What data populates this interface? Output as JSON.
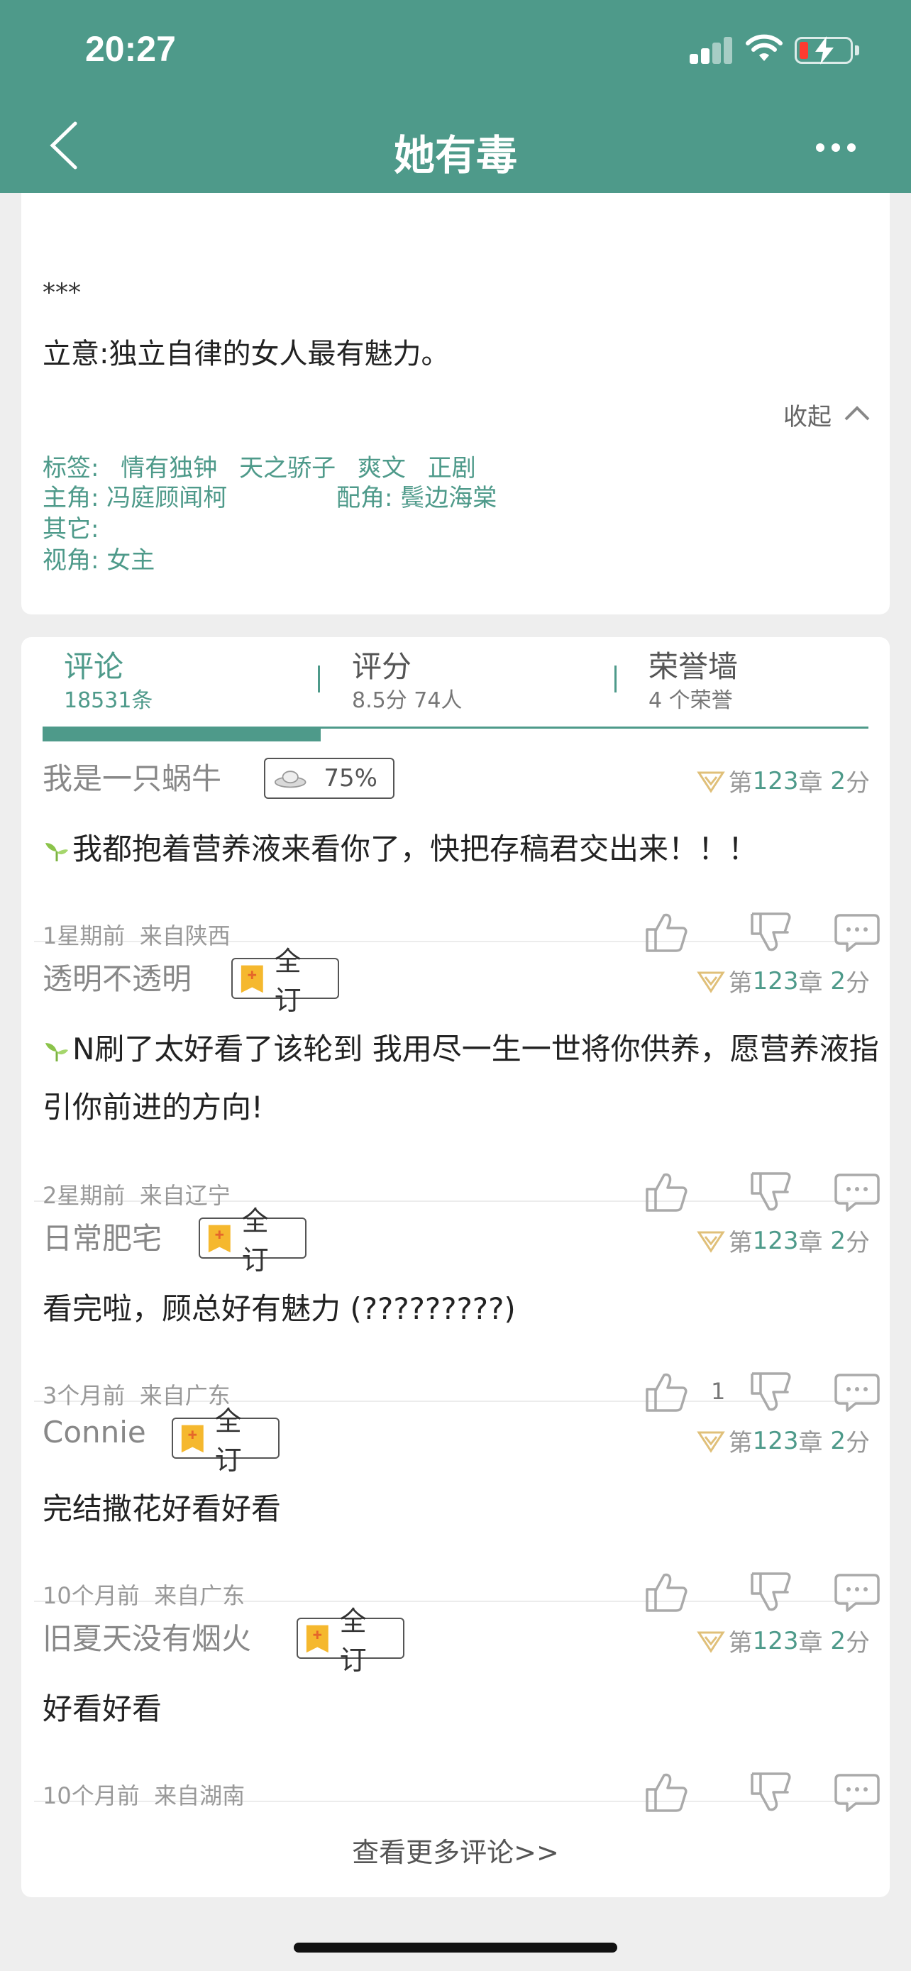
{
  "status": {
    "time": "20:27"
  },
  "header": {
    "title": "她有毒"
  },
  "intro": {
    "divider": "***",
    "theme": "立意:独立自律的女人最有魅力。",
    "collapse_label": "收起",
    "tags_label": "标签:",
    "tags": [
      "情有独钟",
      "天之骄子",
      "爽文",
      "正剧"
    ],
    "lead_label": "主角:",
    "lead": "冯庭顾闻柯",
    "support_label": "配角:",
    "support": "鬓边海棠",
    "other_label": "其它:",
    "pov_label": "视角:",
    "pov": "女主"
  },
  "tabs": [
    {
      "label": "评论",
      "sub": "18531条"
    },
    {
      "label": "评分",
      "sub": "8.5分 74人"
    },
    {
      "label": "荣誉墙",
      "sub": "4 个荣誉"
    }
  ],
  "comments": [
    {
      "user": "我是一只蜗牛",
      "badge_type": "percent",
      "badge": "75%",
      "chap_prefix": "第",
      "chapter": "123",
      "chap_mid": "章",
      "score": "2",
      "score_unit": "分",
      "text": "我都抱着营养液来看你了，快把存稿君交出来！！！",
      "sprout": true,
      "time": "1星期前",
      "location": "来自陕西",
      "likes": ""
    },
    {
      "user": "透明不透明",
      "badge_type": "sub",
      "badge": "全订",
      "chap_prefix": "第",
      "chapter": "123",
      "chap_mid": "章",
      "score": "2",
      "score_unit": "分",
      "text": "N刷了太好看了该轮到 我用尽一生一世将你供养，愿营养液指引你前进的方向!",
      "sprout": true,
      "time": "2星期前",
      "location": "来自辽宁",
      "likes": ""
    },
    {
      "user": "日常肥宅",
      "badge_type": "sub",
      "badge": "全订",
      "chap_prefix": "第",
      "chapter": "123",
      "chap_mid": "章",
      "score": "2",
      "score_unit": "分",
      "text": "看完啦，顾总好有魅力 (?????????)",
      "sprout": false,
      "time": "3个月前",
      "location": "来自广东",
      "likes": "1"
    },
    {
      "user": "Connie",
      "badge_type": "sub",
      "badge": "全订",
      "chap_prefix": "第",
      "chapter": "123",
      "chap_mid": "章",
      "score": "2",
      "score_unit": "分",
      "text": "完结撒花好看好看",
      "sprout": false,
      "time": "10个月前",
      "location": "来自广东",
      "likes": ""
    },
    {
      "user": "旧夏天没有烟火",
      "badge_type": "sub",
      "badge": "全订",
      "chap_prefix": "第",
      "chapter": "123",
      "chap_mid": "章",
      "score": "2",
      "score_unit": "分",
      "text": "好看好看",
      "sprout": false,
      "time": "10个月前",
      "location": "来自湖南",
      "likes": ""
    }
  ],
  "more_comments": "查看更多评论>>",
  "colors": {
    "accent": "#4e9a8a",
    "badge_gold": "#f5b82e"
  }
}
